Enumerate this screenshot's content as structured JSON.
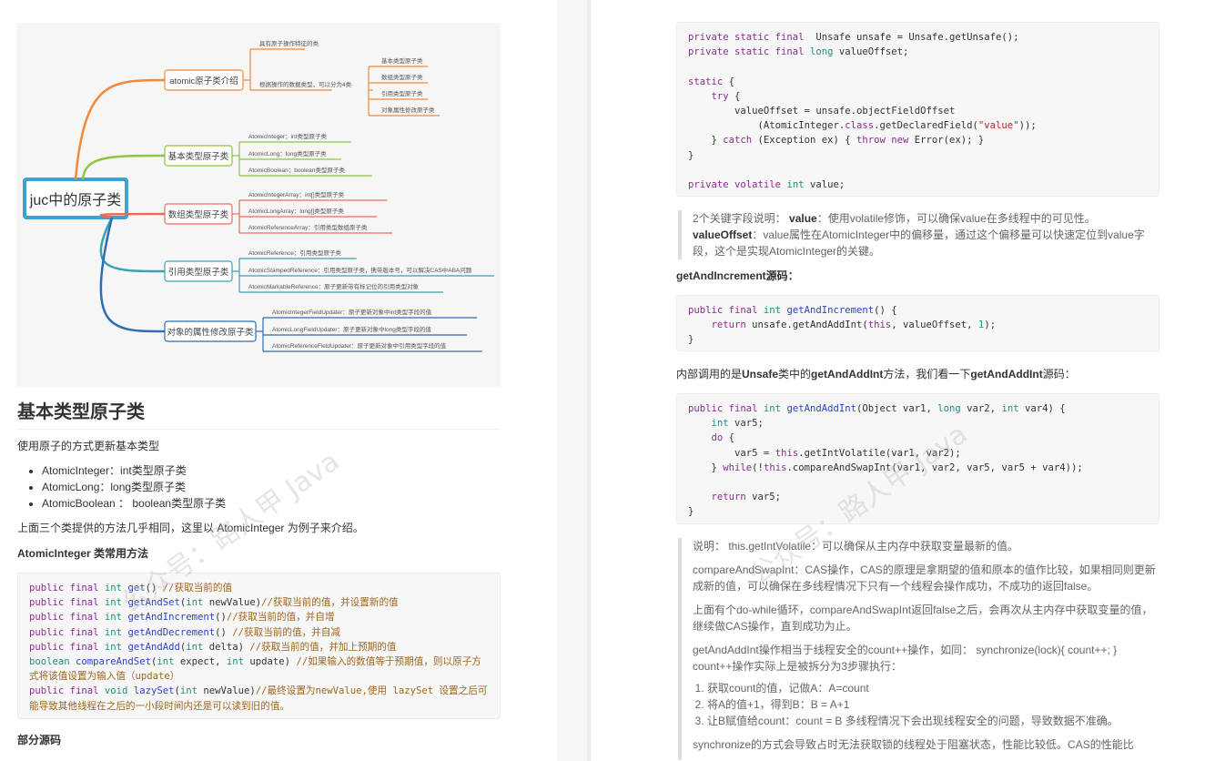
{
  "watermark": "公众号：路人甲 Java",
  "mindmap": {
    "root": "juc中的原子类",
    "branches": [
      {
        "label": "atomic原子类介绍",
        "color": "#ee8a3a",
        "children": [
          "具有原子操作特征的类",
          "根据操作的数据类型，可以分为4类"
        ],
        "grandchildren": [
          "基本类型原子类",
          "数组类型原子类",
          "引用类型原子类",
          "对象属性修改原子类"
        ]
      },
      {
        "label": "基本类型原子类",
        "color": "#8dc63f",
        "children": [
          "AtomicInteger：int类型原子类",
          "AtomicLong：long类型原子类",
          "AtomicBoolean：boolean类型原子类"
        ]
      },
      {
        "label": "数组类型原子类",
        "color": "#ec6a5c",
        "children": [
          "AtomicIntegerArray：int[]类型原子类",
          "AtomicLongArray：long[]类型原子类",
          "AtomicReferenceArray：引用类型数组原子类"
        ]
      },
      {
        "label": "引用类型原子类",
        "color": "#3aa3b0",
        "children": [
          "AtomicReference：引用类型原子类",
          "AtomicStampedReference：引用类型原子类，携带版本号，可以解决CAS中ABA问题",
          "AtomicMarkableReference：原子更新带有标记位的引用类型对象"
        ]
      },
      {
        "label": "对象的属性修改原子类",
        "color": "#2e6db4",
        "children": [
          "AtomicIntegerFieldUpdater：原子更新对象中int类型字段的值",
          "AtomicLongFieldUpdater：原子更新对象中long类型字段的值",
          "AtomicReferenceFieldUpdater：原子更新对象中引用类型字段的值"
        ]
      }
    ]
  },
  "left": {
    "heading": "基本类型原子类",
    "intro": "使用原子的方式更新基本类型",
    "bullets": [
      "AtomicInteger：int类型原子类",
      "AtomicLong：long类型原子类",
      "AtomicBoolean ： boolean类型原子类"
    ],
    "note": "上面三个类提供的方法几乎相同，这里以 AtomicInteger 为例子来介绍。",
    "methods_title": "AtomicInteger 类常用方法",
    "partial_source_title": "部分源码"
  },
  "right": {
    "quote1": {
      "line1_prefix": "2个关键字段说明： ",
      "line1_key": "value",
      "line1_rest": "：使用volatile修饰，可以确保value在多线程中的可见性。",
      "line2_key": "valueOffset",
      "line2_rest": "：value属性在AtomicInteger中的偏移量，通过这个偏移量可以快速定位到value字段，这个是实现AtomicInteger的关键。"
    },
    "getAndIncrement_title": "getAndIncrement源码：",
    "inner_call": {
      "p1": "内部调用的是",
      "b1": "Unsafe",
      "p2": "类中的",
      "b2": "getAndAddInt",
      "p3": "方法，我们看一下",
      "b3": "getAndAddInt",
      "p4": "源码："
    },
    "quote2": {
      "p1": "说明： this.getIntVolatile：可以确保从主内存中获取变量最新的值。",
      "p2": "compareAndSwapInt：CAS操作，CAS的原理是拿期望的值和原本的值作比较，如果相同则更新成新的值，可以确保在多线程情况下只有一个线程会操作成功，不成功的返回false。",
      "p3": "上面有个do-while循环，compareAndSwapInt返回false之后，会再次从主内存中获取变量的值，继续做CAS操作，直到成功为止。",
      "p4": "getAndAddInt操作相当于线程安全的count++操作，如同： synchronize(lock){ count++; } count++操作实际上是被拆分为3步骤执行：",
      "steps": [
        "获取count的值，记做A：A=count",
        "将A的值+1，得到B：B = A+1",
        "让B赋值给count：count = B 多线程情况下会出现线程安全的问题，导致数据不准确。"
      ],
      "p5": "synchronize的方式会导致占时无法获取锁的线程处于阻塞状态，性能比较低。CAS的性能比"
    }
  },
  "code_blocks": {
    "methods": [
      [
        [
          "kw",
          "public final "
        ],
        [
          "ty",
          "int "
        ],
        [
          "fn",
          "get"
        ],
        [
          "",
          "() "
        ],
        [
          "cm",
          "//获取当前的值"
        ]
      ],
      [
        [
          "kw",
          "public final "
        ],
        [
          "ty",
          "int "
        ],
        [
          "fn",
          "getAndSet"
        ],
        [
          "",
          "("
        ],
        [
          "ty",
          "int"
        ],
        [
          "",
          " newValue)"
        ],
        [
          "cm",
          "//获取当前的值，并设置新的值"
        ]
      ],
      [
        [
          "kw",
          "public final "
        ],
        [
          "ty",
          "int "
        ],
        [
          "fn",
          "getAndIncrement"
        ],
        [
          "",
          "()"
        ],
        [
          "cm",
          "//获取当前的值，并自增"
        ]
      ],
      [
        [
          "kw",
          "public final "
        ],
        [
          "ty",
          "int "
        ],
        [
          "fn",
          "getAndDecrement"
        ],
        [
          "",
          "() "
        ],
        [
          "cm",
          "//获取当前的值，并自减"
        ]
      ],
      [
        [
          "kw",
          "public final "
        ],
        [
          "ty",
          "int "
        ],
        [
          "fn",
          "getAndAdd"
        ],
        [
          "",
          "("
        ],
        [
          "ty",
          "int"
        ],
        [
          "",
          " delta) "
        ],
        [
          "cm",
          "//获取当前的值，并加上预期的值"
        ]
      ],
      [
        [
          "ty",
          "boolean "
        ],
        [
          "fn",
          "compareAndSet"
        ],
        [
          "",
          "("
        ],
        [
          "ty",
          "int"
        ],
        [
          "",
          " expect, "
        ],
        [
          "ty",
          "int"
        ],
        [
          "",
          " update) "
        ],
        [
          "cm",
          "//如果输入的数值等于预期值，则以原子方式将该值设置为输入值（update）"
        ]
      ],
      [
        [
          "kw",
          "public final "
        ],
        [
          "ty",
          "void "
        ],
        [
          "fn",
          "lazySet"
        ],
        [
          "",
          "("
        ],
        [
          "ty",
          "int"
        ],
        [
          "",
          " newValue)"
        ],
        [
          "cm",
          "//最终设置为newValue,使用 lazySet 设置之后可能导致其他线程在之后的一小段时间内还是可以读到旧的值。"
        ]
      ]
    ],
    "fields": [
      [
        [
          "kw",
          "private static final "
        ],
        [
          "",
          " Unsafe unsafe = Unsafe.getUnsafe();"
        ]
      ],
      [
        [
          "kw",
          "private static final "
        ],
        [
          "ty",
          "long"
        ],
        [
          "",
          " valueOffset;"
        ]
      ],
      [
        [
          "",
          ""
        ]
      ],
      [
        [
          "kw",
          "static"
        ],
        [
          "",
          " {"
        ]
      ],
      [
        [
          "",
          "    "
        ],
        [
          "kw",
          "try"
        ],
        [
          "",
          " {"
        ]
      ],
      [
        [
          "",
          "        valueOffset = unsafe.objectFieldOffset"
        ]
      ],
      [
        [
          "",
          "            (AtomicInteger."
        ],
        [
          "kw",
          "class"
        ],
        [
          "",
          ".getDeclaredField("
        ],
        [
          "st",
          "\"value\""
        ],
        [
          "",
          "));"
        ]
      ],
      [
        [
          "",
          "    } "
        ],
        [
          "kw",
          "catch"
        ],
        [
          "",
          " (Exception ex) { "
        ],
        [
          "kw",
          "throw new"
        ],
        [
          "",
          " Error(ex); }"
        ]
      ],
      [
        [
          "",
          "}"
        ]
      ],
      [
        [
          "",
          ""
        ]
      ],
      [
        [
          "kw",
          "private volatile "
        ],
        [
          "ty",
          "int"
        ],
        [
          "",
          " value;"
        ]
      ]
    ],
    "getAndIncrement": [
      [
        [
          "kw",
          "public final "
        ],
        [
          "ty",
          "int "
        ],
        [
          "fn",
          "getAndIncrement"
        ],
        [
          "",
          "() {"
        ]
      ],
      [
        [
          "",
          "    "
        ],
        [
          "kw",
          "return"
        ],
        [
          "",
          " unsafe.getAndAddInt("
        ],
        [
          "kw",
          "this"
        ],
        [
          "",
          ", valueOffset, "
        ],
        [
          "nm",
          "1"
        ],
        [
          "",
          ");"
        ]
      ],
      [
        [
          "",
          "}"
        ]
      ]
    ],
    "getAndAddInt": [
      [
        [
          "kw",
          "public final "
        ],
        [
          "ty",
          "int "
        ],
        [
          "fn",
          "getAndAddInt"
        ],
        [
          "",
          "(Object var1, "
        ],
        [
          "ty",
          "long"
        ],
        [
          "",
          " var2, "
        ],
        [
          "ty",
          "int"
        ],
        [
          "",
          " var4) {"
        ]
      ],
      [
        [
          "",
          "    "
        ],
        [
          "ty",
          "int"
        ],
        [
          "",
          " var5;"
        ]
      ],
      [
        [
          "",
          "    "
        ],
        [
          "kw",
          "do"
        ],
        [
          "",
          " {"
        ]
      ],
      [
        [
          "",
          "        var5 = "
        ],
        [
          "kw",
          "this"
        ],
        [
          "",
          ".getIntVolatile(var1, var2);"
        ]
      ],
      [
        [
          "",
          "    } "
        ],
        [
          "kw",
          "while"
        ],
        [
          "",
          "(!"
        ],
        [
          "kw",
          "this"
        ],
        [
          "",
          ".compareAndSwapInt(var1, var2, var5, var5 + var4));"
        ]
      ],
      [
        [
          "",
          ""
        ]
      ],
      [
        [
          "",
          "    "
        ],
        [
          "kw",
          "return"
        ],
        [
          "",
          " var5;"
        ]
      ],
      [
        [
          "",
          "}"
        ]
      ]
    ]
  }
}
